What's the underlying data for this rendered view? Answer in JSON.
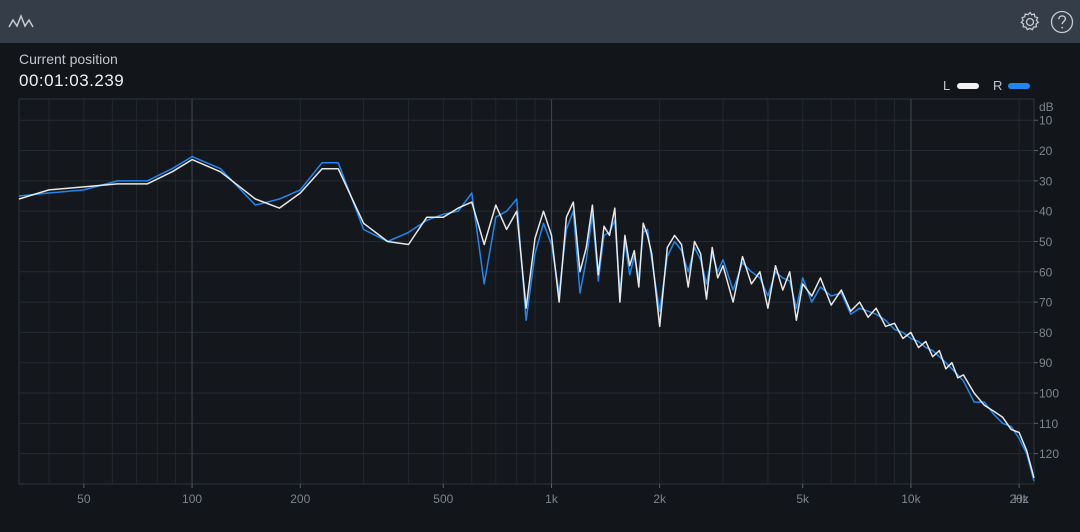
{
  "header": {
    "logo_icon": "waveform-icon",
    "settings_icon": "gear-icon",
    "help_icon": "help-icon"
  },
  "position": {
    "label": "Current position",
    "value": "00:01:03.239"
  },
  "legend": {
    "left": {
      "label": "L",
      "color": "#f2f2f2"
    },
    "right": {
      "label": "R",
      "color": "#1e88f0"
    }
  },
  "chart_data": {
    "type": "line",
    "x_scale": "log",
    "xlim": [
      33,
      22000
    ],
    "ylim": [
      -130,
      -3
    ],
    "x_unit_label": "Hz",
    "y_unit_label": "dB",
    "x_ticks": [
      {
        "value": 50,
        "label": "50"
      },
      {
        "value": 100,
        "label": "100"
      },
      {
        "value": 200,
        "label": "200"
      },
      {
        "value": 500,
        "label": "500"
      },
      {
        "value": 1000,
        "label": "1k"
      },
      {
        "value": 2000,
        "label": "2k"
      },
      {
        "value": 5000,
        "label": "5k"
      },
      {
        "value": 10000,
        "label": "10k"
      },
      {
        "value": 20000,
        "label": "20k"
      }
    ],
    "y_ticks": [
      {
        "value": -10,
        "label": "10"
      },
      {
        "value": -20,
        "label": "20"
      },
      {
        "value": -30,
        "label": "30"
      },
      {
        "value": -40,
        "label": "40"
      },
      {
        "value": -50,
        "label": "50"
      },
      {
        "value": -60,
        "label": "60"
      },
      {
        "value": -70,
        "label": "70"
      },
      {
        "value": -80,
        "label": "80"
      },
      {
        "value": -90,
        "label": "90"
      },
      {
        "value": -100,
        "label": "100"
      },
      {
        "value": -110,
        "label": "110"
      },
      {
        "value": -120,
        "label": "120"
      }
    ],
    "series": [
      {
        "name": "L",
        "color": "#f2f2f2",
        "x": [
          33,
          40,
          50,
          62,
          75,
          88,
          100,
          120,
          150,
          175,
          200,
          230,
          255,
          300,
          350,
          400,
          450,
          500,
          550,
          600,
          650,
          700,
          750,
          800,
          850,
          900,
          950,
          1000,
          1050,
          1100,
          1150,
          1200,
          1250,
          1300,
          1350,
          1400,
          1450,
          1500,
          1550,
          1600,
          1650,
          1700,
          1750,
          1800,
          1850,
          1900,
          2000,
          2100,
          2200,
          2300,
          2400,
          2500,
          2600,
          2700,
          2800,
          2900,
          3000,
          3200,
          3400,
          3600,
          3800,
          4000,
          4200,
          4400,
          4600,
          4800,
          5000,
          5300,
          5600,
          6000,
          6400,
          6800,
          7200,
          7600,
          8000,
          8500,
          9000,
          9500,
          10000,
          10500,
          11000,
          11500,
          12000,
          12500,
          13000,
          13500,
          14000,
          15000,
          16000,
          17000,
          18000,
          19000,
          20000,
          21000,
          22000
        ],
        "y": [
          -36,
          -33,
          -32,
          -31,
          -31,
          -27,
          -23,
          -27,
          -36,
          -39,
          -34,
          -26,
          -26,
          -44,
          -50,
          -51,
          -42,
          -42,
          -39,
          -37,
          -51,
          -38,
          -46,
          -40,
          -72,
          -49,
          -40,
          -48,
          -70,
          -42,
          -37,
          -60,
          -52,
          -38,
          -61,
          -45,
          -48,
          -39,
          -70,
          -48,
          -58,
          -53,
          -65,
          -44,
          -48,
          -54,
          -78,
          -52,
          -48,
          -51,
          -65,
          -50,
          -54,
          -69,
          -52,
          -62,
          -58,
          -70,
          -55,
          -64,
          -60,
          -72,
          -58,
          -66,
          -60,
          -76,
          -64,
          -68,
          -62,
          -71,
          -66,
          -73,
          -70,
          -75,
          -72,
          -78,
          -77,
          -82,
          -80,
          -85,
          -83,
          -88,
          -86,
          -92,
          -90,
          -95,
          -94,
          -100,
          -104,
          -106,
          -108,
          -112,
          -113,
          -119,
          -128
        ]
      },
      {
        "name": "R",
        "color": "#1e88f0",
        "x": [
          33,
          40,
          50,
          62,
          75,
          88,
          100,
          120,
          150,
          175,
          200,
          230,
          255,
          300,
          350,
          400,
          450,
          500,
          550,
          600,
          650,
          700,
          750,
          800,
          850,
          900,
          950,
          1000,
          1050,
          1100,
          1150,
          1200,
          1250,
          1300,
          1350,
          1400,
          1450,
          1500,
          1550,
          1600,
          1650,
          1700,
          1750,
          1800,
          1850,
          1900,
          2000,
          2100,
          2200,
          2300,
          2400,
          2500,
          2600,
          2700,
          2800,
          2900,
          3000,
          3200,
          3400,
          3600,
          3800,
          4000,
          4200,
          4400,
          4600,
          4800,
          5000,
          5300,
          5600,
          6000,
          6400,
          6800,
          7200,
          7600,
          8000,
          8500,
          9000,
          9500,
          10000,
          10500,
          11000,
          11500,
          12000,
          12500,
          13000,
          13500,
          14000,
          15000,
          16000,
          17000,
          18000,
          19000,
          20000,
          21000,
          22000
        ],
        "y": [
          -35,
          -34,
          -33,
          -30,
          -30,
          -26,
          -22,
          -26,
          -38,
          -36,
          -33,
          -24,
          -24,
          -46,
          -50,
          -47,
          -43,
          -41,
          -40,
          -34,
          -64,
          -42,
          -40,
          -36,
          -76,
          -54,
          -44,
          -51,
          -67,
          -46,
          -40,
          -67,
          -56,
          -41,
          -63,
          -48,
          -47,
          -43,
          -67,
          -50,
          -61,
          -55,
          -62,
          -47,
          -46,
          -56,
          -73,
          -55,
          -50,
          -53,
          -60,
          -52,
          -56,
          -64,
          -54,
          -60,
          -56,
          -66,
          -57,
          -60,
          -62,
          -68,
          -60,
          -62,
          -63,
          -72,
          -62,
          -70,
          -65,
          -68,
          -67,
          -74,
          -72,
          -73,
          -74,
          -76,
          -79,
          -80,
          -82,
          -83,
          -85,
          -86,
          -88,
          -90,
          -92,
          -94,
          -96,
          -103,
          -103,
          -107,
          -110,
          -111,
          -115,
          -120,
          -129
        ]
      }
    ]
  }
}
